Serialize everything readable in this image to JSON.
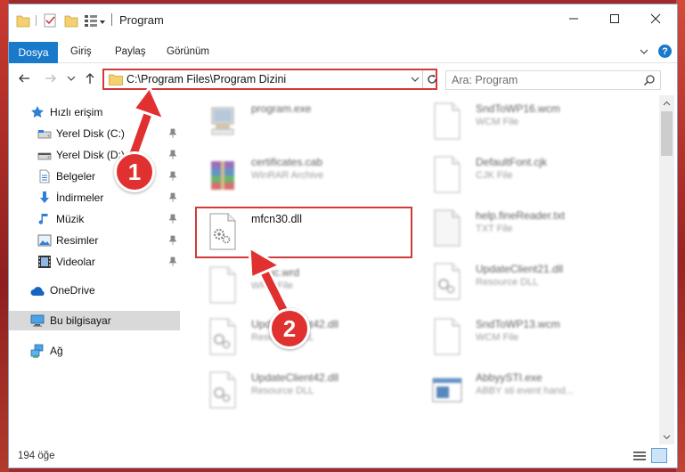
{
  "window": {
    "title": "Program",
    "accent": "#1979ca",
    "highlight": "#d13a3a"
  },
  "ribbon": {
    "tabs": [
      {
        "label": "Dosya",
        "icon": "file-tab"
      },
      {
        "label": "Giriş"
      },
      {
        "label": "Paylaş"
      },
      {
        "label": "Görünüm"
      }
    ],
    "help": "?"
  },
  "navigation": {
    "address": "C:\\Program Files\\Program Dizini",
    "search_placeholder": "Ara: Program"
  },
  "sidebar": {
    "items": [
      {
        "label": "Hızlı erişim",
        "icon": "star-icon",
        "pinned": false
      },
      {
        "label": "Yerel Disk (C:)",
        "icon": "drive-icon",
        "pinned": true
      },
      {
        "label": "Yerel Disk (D:)",
        "icon": "drive-icon",
        "pinned": true
      },
      {
        "label": "Belgeler",
        "icon": "documents-icon",
        "pinned": true
      },
      {
        "label": "İndirmeler",
        "icon": "download-icon",
        "pinned": true
      },
      {
        "label": "Müzik",
        "icon": "music-icon",
        "pinned": true
      },
      {
        "label": "Resimler",
        "icon": "pictures-icon",
        "pinned": true
      },
      {
        "label": "Videolar",
        "icon": "videos-icon",
        "pinned": true
      },
      {
        "label": "OneDrive",
        "icon": "cloud-icon",
        "pinned": false
      },
      {
        "label": "Bu bilgisayar",
        "icon": "computer-icon",
        "pinned": false,
        "selected": true
      },
      {
        "label": "Ağ",
        "icon": "network-icon",
        "pinned": false
      }
    ]
  },
  "files": [
    {
      "name": "program.exe",
      "type": "",
      "icon": "exe-icon"
    },
    {
      "name": "certificates.cab",
      "type": "WinRAR Archive",
      "icon": "archive-icon"
    },
    {
      "name": "mfcn30.dll",
      "type": "",
      "icon": "dll-icon",
      "highlighted": true
    },
    {
      "name": "music.wrd",
      "type": "WRD File",
      "icon": "blank-file-icon"
    },
    {
      "name": "UpdateClient42.dll",
      "type": "Resource DLL",
      "icon": "dll-icon"
    },
    {
      "name": "UpdateClient42.dll",
      "type": "Resource DLL",
      "icon": "dll-icon"
    },
    {
      "name": "SndToWP16.wcm",
      "type": "WCM File",
      "icon": "blank-file-icon"
    },
    {
      "name": "DefaultFont.cjk",
      "type": "CJK File",
      "icon": "blank-file-icon"
    },
    {
      "name": "help.fineReader.txt",
      "type": "TXT File",
      "icon": "text-file-icon"
    },
    {
      "name": "UpdateClient21.dll",
      "type": "Resource DLL",
      "icon": "dll-icon"
    },
    {
      "name": "SndToWP13.wcm",
      "type": "WCM File",
      "icon": "blank-file-icon"
    },
    {
      "name": "AbbyySTI.exe",
      "type": "ABBY sti event hand...",
      "icon": "app-window-icon"
    }
  ],
  "status": {
    "count": "194 öğe"
  },
  "callouts": [
    "1",
    "2"
  ]
}
